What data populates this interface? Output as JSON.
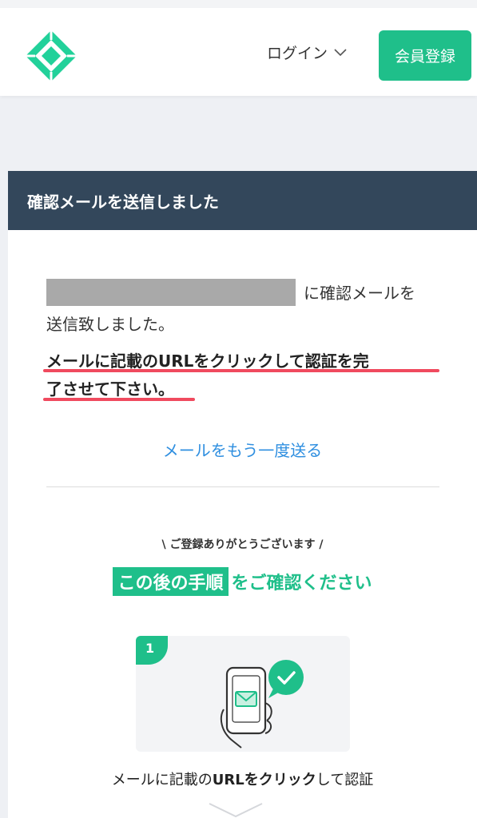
{
  "header": {
    "login_label": "ログイン",
    "register_label": "会員登録"
  },
  "card": {
    "title": "確認メールを送信しました",
    "sent_line1": "に確認メールを",
    "sent_line2": "送信致しました。",
    "instruction_line1": "メールに記載のURLをクリックして認証を完",
    "instruction_line2": "了させて下さい。",
    "resend_link": "メールをもう一度送る",
    "thanks_text": "\\ ご登録ありがとうございます /",
    "next_highlight": "この後の手順",
    "next_rest": "をご確認ください",
    "step1": {
      "number": "1",
      "caption_pre": "メールに記載の",
      "caption_bold": "URLをクリック",
      "caption_post": "して認証"
    }
  },
  "colors": {
    "brand_green": "#1fbf8a",
    "header_navy": "#33475b",
    "link_blue": "#2f8fe0",
    "underline_red": "#f04a5e"
  },
  "icons": [
    "logo-icon",
    "chevron-down-icon",
    "phone-mail-illustration",
    "check-bubble-icon"
  ]
}
